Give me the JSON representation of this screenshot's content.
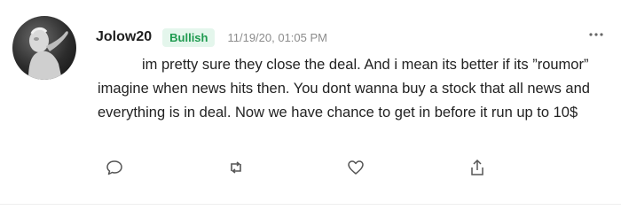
{
  "post": {
    "username": "Jolow20",
    "sentiment": "Bullish",
    "timestamp": "11/19/20, 01:05 PM",
    "more_icon": "ellipsis-icon",
    "body": "im pretty sure they close the deal. And i mean its better if its ”roumor” imagine when news hits then. You dont wanna buy a stock that all news and everything is in deal. Now we have chance to get in before it run up to 10$"
  },
  "actions": [
    {
      "icon": "comment-icon"
    },
    {
      "icon": "repost-icon"
    },
    {
      "icon": "heart-icon"
    },
    {
      "icon": "share-icon"
    }
  ],
  "colors": {
    "bullish_text": "#1e9a4f",
    "bullish_bg": "#e4f6ec",
    "text": "#222222",
    "muted": "#8c8c8c"
  }
}
